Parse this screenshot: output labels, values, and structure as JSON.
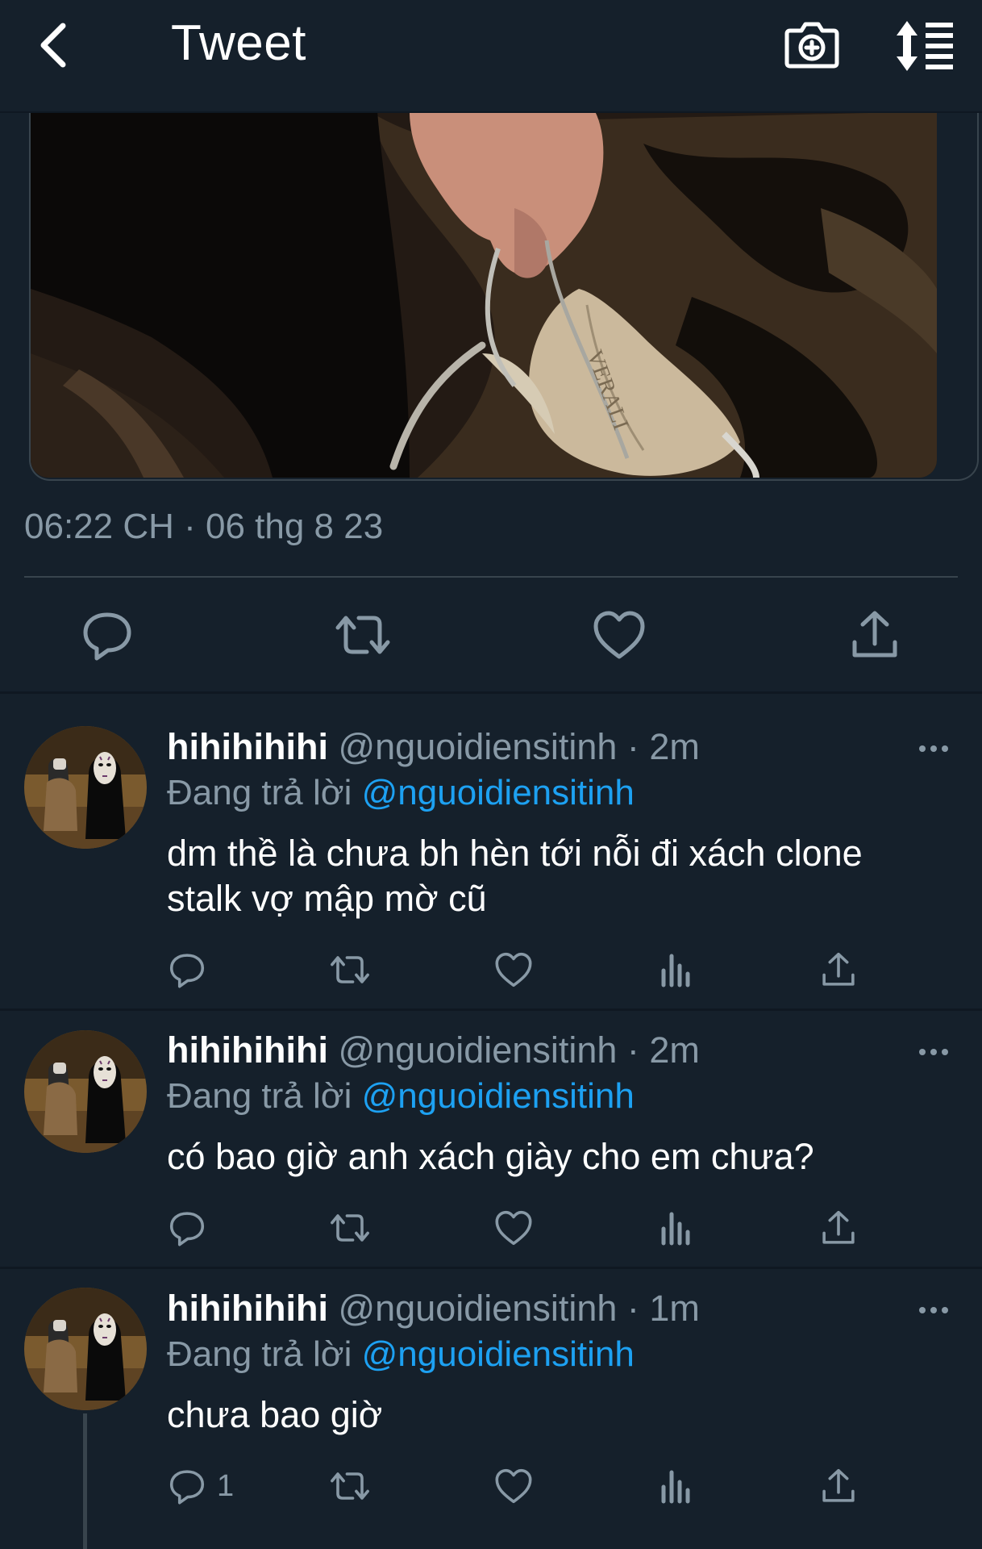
{
  "header": {
    "title": "Tweet"
  },
  "tweet": {
    "image_text": "VERALI",
    "timestamp": "06:22 CH · 06 thg 8 23"
  },
  "replies": [
    {
      "name": "hihihihihi",
      "handle": "@nguoidiensitinh · 2m",
      "replying_label": "Đang trả lời",
      "replying_to": "@nguoidiensitinh",
      "text": "dm thề là chưa bh hèn tới nỗi đi xách clone stalk vợ mập mờ cũ",
      "reply_count": ""
    },
    {
      "name": "hihihihihi",
      "handle": "@nguoidiensitinh · 2m",
      "replying_label": "Đang trả lời",
      "replying_to": "@nguoidiensitinh",
      "text": "có bao giờ anh xách giày cho em chưa?",
      "reply_count": ""
    },
    {
      "name": "hihihihihi",
      "handle": "@nguoidiensitinh · 1m",
      "replying_label": "Đang trả lời",
      "replying_to": "@nguoidiensitinh",
      "text": "chưa bao giờ",
      "reply_count": "1"
    }
  ],
  "colors": {
    "background": "#15202b",
    "muted": "#8899a6",
    "link": "#1da1f2",
    "border": "#38444d"
  },
  "icons": [
    "back-chevron-icon",
    "camera-plus-icon",
    "sort-icon",
    "reply-icon",
    "retweet-icon",
    "like-icon",
    "share-icon",
    "analytics-icon",
    "more-icon"
  ]
}
